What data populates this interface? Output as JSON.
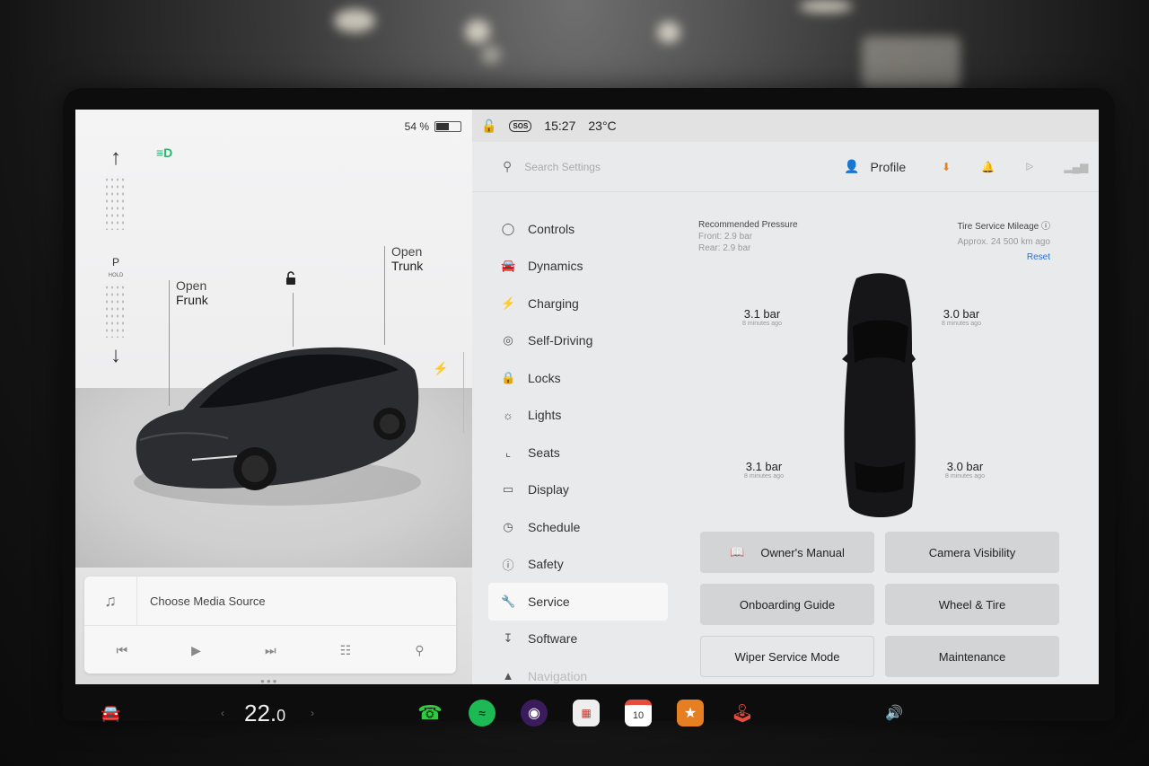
{
  "status": {
    "battery_pct": "54 %",
    "battery_level": 0.54,
    "time": "15:27",
    "temperature": "23°C",
    "sos": "SOS"
  },
  "car_panel": {
    "gear": "P",
    "hold": "HOLD",
    "frunk": {
      "line1": "Open",
      "line2": "Frunk"
    },
    "trunk": {
      "line1": "Open",
      "line2": "Trunk"
    }
  },
  "media": {
    "source": "Choose Media Source"
  },
  "header": {
    "search_placeholder": "Search Settings",
    "profile": "Profile"
  },
  "nav": {
    "items": [
      {
        "label": "Controls",
        "icon": "toggle-icon"
      },
      {
        "label": "Dynamics",
        "icon": "car-icon"
      },
      {
        "label": "Charging",
        "icon": "bolt-icon"
      },
      {
        "label": "Self-Driving",
        "icon": "steering-wheel-icon"
      },
      {
        "label": "Locks",
        "icon": "lock-icon"
      },
      {
        "label": "Lights",
        "icon": "sun-icon"
      },
      {
        "label": "Seats",
        "icon": "seat-icon"
      },
      {
        "label": "Display",
        "icon": "display-icon"
      },
      {
        "label": "Schedule",
        "icon": "clock-icon"
      },
      {
        "label": "Safety",
        "icon": "alert-icon"
      },
      {
        "label": "Service",
        "icon": "wrench-icon"
      },
      {
        "label": "Software",
        "icon": "download-icon"
      },
      {
        "label": "Navigation",
        "icon": "navigation-icon"
      }
    ],
    "active": "Service"
  },
  "service": {
    "recommended_title": "Recommended Pressure",
    "front": "Front: 2.9 bar",
    "rear": "Rear: 2.9 bar",
    "mileage_title": "Tire Service Mileage",
    "mileage_value": "Approx. 24 500 km ago",
    "reset": "Reset",
    "tires": {
      "front_left": {
        "value": "3.1 bar",
        "time": "8 minutes ago"
      },
      "front_right": {
        "value": "3.0 bar",
        "time": "8 minutes ago"
      },
      "rear_left": {
        "value": "3.1 bar",
        "time": "8 minutes ago"
      },
      "rear_right": {
        "value": "3.0 bar",
        "time": "8 minutes ago"
      }
    },
    "buttons": {
      "owners_manual": "Owner's Manual",
      "camera_visibility": "Camera Visibility",
      "onboarding_guide": "Onboarding Guide",
      "wheel_tire": "Wheel & Tire",
      "wiper_service": "Wiper Service Mode",
      "maintenance": "Maintenance"
    }
  },
  "dock": {
    "temp_int": "22.",
    "temp_dec": "0",
    "calendar_day": "10"
  }
}
